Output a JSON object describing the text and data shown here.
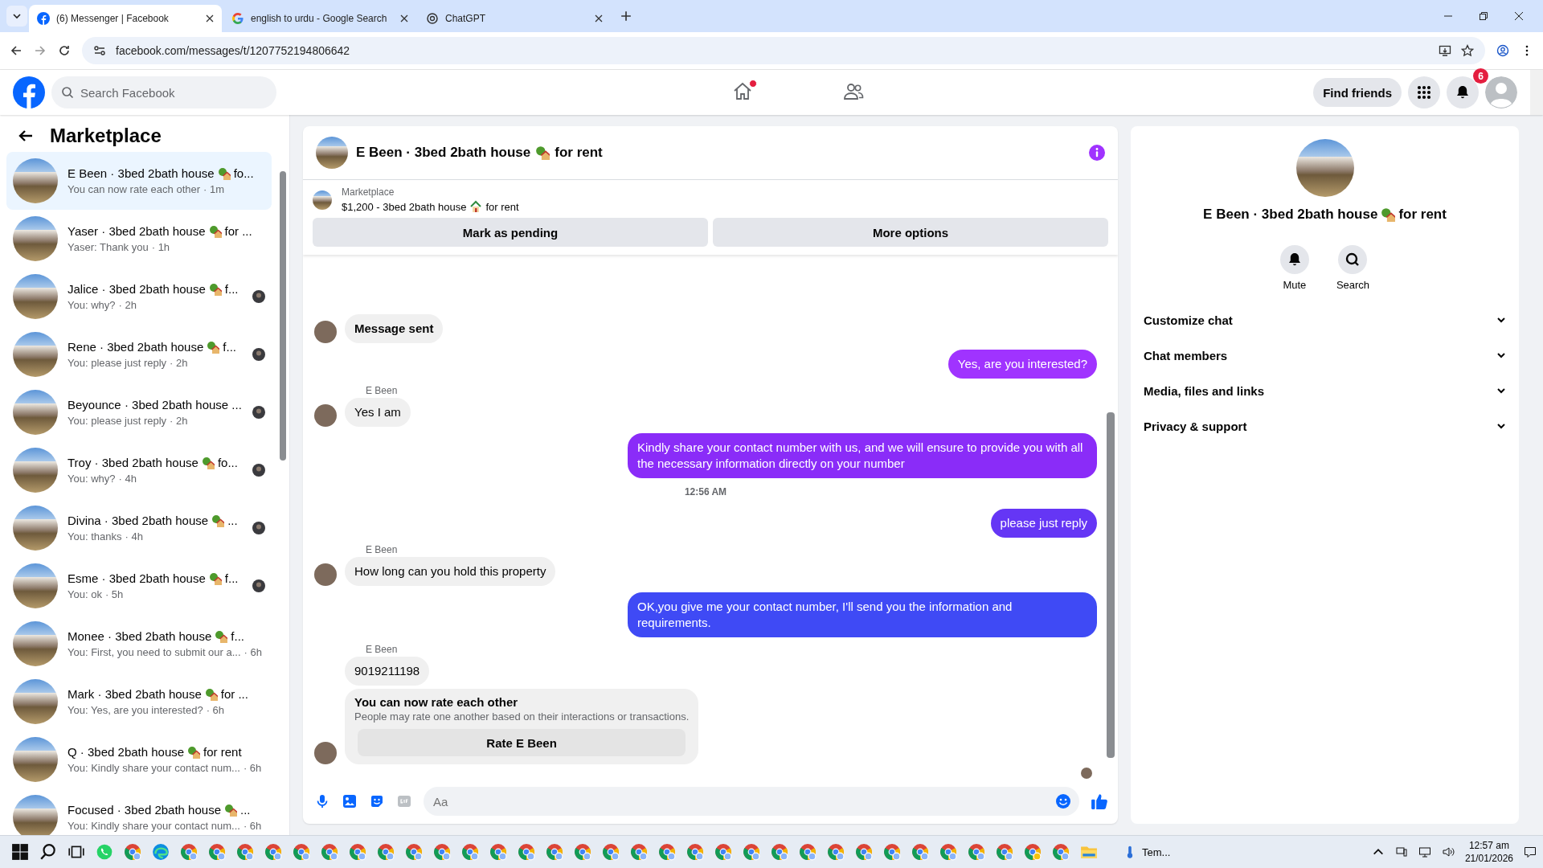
{
  "browser": {
    "tabs": [
      {
        "title": "(6) Messenger | Facebook",
        "selected": true
      },
      {
        "title": "english to urdu - Google Search",
        "selected": false
      },
      {
        "title": "ChatGPT",
        "selected": false
      }
    ],
    "address": "facebook.com/messages/t/1207752194806642"
  },
  "header": {
    "search_placeholder": "Search Facebook",
    "find_friends": "Find friends",
    "notification_count": "6",
    "nav": [
      {
        "kind": "home",
        "dot": true
      },
      {
        "kind": "friends",
        "dot": false
      }
    ]
  },
  "sidebar": {
    "title": "Marketplace",
    "conversations": [
      {
        "title": "E Been · 3bed 2bath house",
        "end": "fo...",
        "preview": "You can now rate each other",
        "time": "· 1m",
        "selected": true
      },
      {
        "title": "Yaser · 3bed 2bath house",
        "end": "for ...",
        "preview": "Yaser: Thank you",
        "time": "· 1h",
        "selected": false
      },
      {
        "title": "Jalice · 3bed 2bath house",
        "end": "f...",
        "preview": "You: why?",
        "time": "· 2h",
        "selected": false,
        "seen": true
      },
      {
        "title": "Rene · 3bed 2bath house",
        "end": "f...",
        "preview": "You: please just reply",
        "time": "· 2h",
        "selected": false,
        "seen": true
      },
      {
        "title": "Beyounce · 3bed 2bath house ...",
        "preview": "You: please just reply",
        "time": "· 2h",
        "selected": false,
        "seen": true
      },
      {
        "title": "Troy · 3bed 2bath house",
        "end": "fo...",
        "preview": "You: why?",
        "time": "· 4h",
        "selected": false,
        "seen": true
      },
      {
        "title": "Divina · 3bed 2bath house",
        "end": "...",
        "preview": "You: thanks",
        "time": "· 4h",
        "selected": false,
        "seen": true
      },
      {
        "title": "Esme · 3bed 2bath house",
        "end": "f...",
        "preview": "You: ok",
        "time": "· 5h",
        "selected": false,
        "seen": true
      },
      {
        "title": "Monee · 3bed 2bath house",
        "end": "f...",
        "preview": "You: First, you need to submit our a...",
        "time": "· 6h",
        "selected": false
      },
      {
        "title": "Mark · 3bed 2bath house",
        "end": "for ...",
        "preview": "You: Yes, are you interested?",
        "time": "· 6h",
        "selected": false
      },
      {
        "title": "Q · 3bed 2bath house",
        "end": "for rent",
        "preview": "You: Kindly share your contact num...",
        "time": "· 6h",
        "selected": false
      },
      {
        "title": "Focused · 3bed 2bath house",
        "end": "...",
        "preview": "You: Kindly share your contact num...",
        "time": "· 6h",
        "selected": false
      }
    ]
  },
  "chat": {
    "title": "E Been · 3bed 2bath house",
    "title_end": "for rent",
    "listing": {
      "label": "Marketplace",
      "price": "$1,200 - 3bed 2bath house",
      "end": "for rent"
    },
    "buttons": [
      "Mark as pending",
      "More options"
    ],
    "messages": [
      {
        "kind": "in",
        "text": "Message sent",
        "bold": true,
        "avatar": true
      },
      {
        "kind": "out",
        "text": "Yes, are you interested?",
        "color": "#a033ff"
      },
      {
        "kind": "in",
        "sender": "E Been",
        "text": "Yes I am",
        "avatar": true
      },
      {
        "kind": "out",
        "text": "Kindly share your contact number with us, and we will ensure to provide you with all the necessary information directly on your number",
        "color": "#8a2cf8"
      },
      {
        "kind": "time",
        "text": "12:56 AM"
      },
      {
        "kind": "out",
        "text": "please just reply",
        "color": "#6536f5"
      },
      {
        "kind": "in",
        "sender": "E Been",
        "text": "How long can you hold this property",
        "avatar": true
      },
      {
        "kind": "out",
        "text": "OK,you give me your contact number, I'll send you the information and requirements.",
        "color": "#3f4af5"
      },
      {
        "kind": "in",
        "sender": "E Been",
        "text": "9019211198",
        "avatar": false
      },
      {
        "kind": "rating",
        "title": "You can now rate each other",
        "body": "People may rate one another based on their interactions or transactions.",
        "button": "Rate E Been",
        "avatar": true
      }
    ],
    "composer_placeholder": "Aa"
  },
  "details": {
    "title": "E Been · 3bed 2bath house",
    "title_end": "for rent",
    "actions": [
      {
        "kind": "mute",
        "label": "Mute"
      },
      {
        "kind": "search",
        "label": "Search"
      }
    ],
    "sections": [
      {
        "label": "Customize chat",
        "expanded": false
      },
      {
        "label": "Chat members",
        "expanded": false
      },
      {
        "label": "Media, files and links",
        "expanded": false
      },
      {
        "label": "Privacy & support",
        "expanded": false
      }
    ]
  },
  "taskbar": {
    "apps": [
      {
        "kind": "whatsapp"
      },
      {
        "kind": "chrome"
      },
      {
        "kind": "edge"
      },
      {
        "kind": "chrome"
      },
      {
        "kind": "chrome"
      },
      {
        "kind": "chrome"
      },
      {
        "kind": "chrome"
      },
      {
        "kind": "chrome"
      },
      {
        "kind": "chrome"
      },
      {
        "kind": "chrome"
      },
      {
        "kind": "chrome"
      },
      {
        "kind": "chrome"
      },
      {
        "kind": "chrome"
      },
      {
        "kind": "chrome"
      },
      {
        "kind": "chrome"
      },
      {
        "kind": "chrome"
      },
      {
        "kind": "chrome"
      },
      {
        "kind": "chrome"
      },
      {
        "kind": "chrome"
      },
      {
        "kind": "chrome"
      },
      {
        "kind": "chrome"
      },
      {
        "kind": "chrome"
      },
      {
        "kind": "chrome"
      },
      {
        "kind": "chrome"
      },
      {
        "kind": "chrome"
      },
      {
        "kind": "chrome"
      },
      {
        "kind": "chrome"
      },
      {
        "kind": "chrome"
      },
      {
        "kind": "chrome"
      },
      {
        "kind": "chrome"
      },
      {
        "kind": "chrome"
      },
      {
        "kind": "chrome"
      },
      {
        "kind": "chrome"
      },
      {
        "kind": "chrome-yellow"
      },
      {
        "kind": "chrome"
      },
      {
        "kind": "folder"
      }
    ],
    "weather": "Tem...",
    "time": "12:57 am",
    "date": "21/01/2026"
  }
}
